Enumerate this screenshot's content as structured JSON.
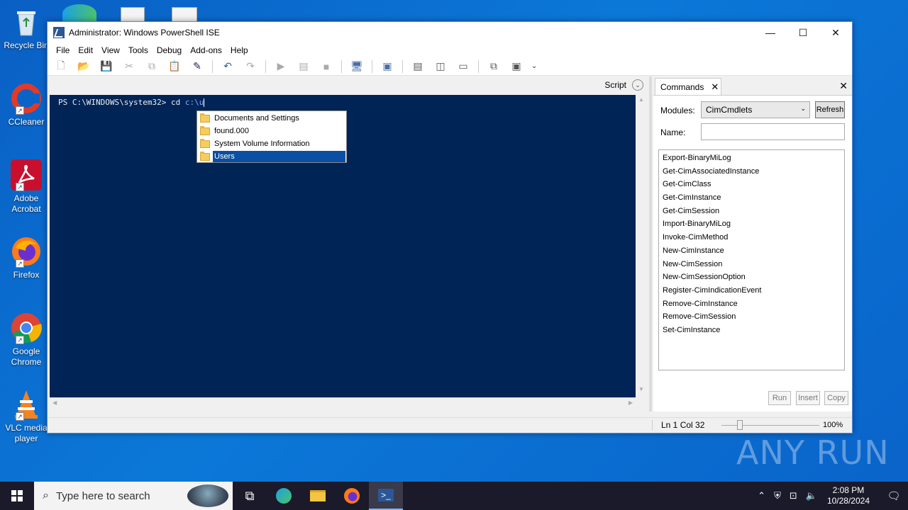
{
  "desktop": {
    "icons": [
      {
        "label": "Recycle Bin",
        "icon": "recycle-bin-icon"
      },
      {
        "label": "CCleaner",
        "icon": "ccleaner-icon"
      },
      {
        "label": "Adobe Acrobat",
        "icon": "adobe-acrobat-icon"
      },
      {
        "label": "Firefox",
        "icon": "firefox-icon"
      },
      {
        "label": "Google Chrome",
        "icon": "chrome-icon"
      },
      {
        "label": "VLC media player",
        "icon": "vlc-icon"
      }
    ],
    "watermark": "ANY RUN"
  },
  "window": {
    "title": "Administrator: Windows PowerShell ISE",
    "menu": [
      "File",
      "Edit",
      "View",
      "Tools",
      "Debug",
      "Add-ons",
      "Help"
    ],
    "script_label": "Script"
  },
  "console": {
    "prompt": "PS C:\\WINDOWS\\system32>",
    "command": "cd",
    "argument": "c:\\u"
  },
  "autocomplete": {
    "items": [
      "Documents and Settings",
      "found.000",
      "System Volume Information",
      "Users"
    ],
    "selected": "Users"
  },
  "commands_pane": {
    "tab_label": "Commands",
    "modules_label": "Modules:",
    "module_selected": "CimCmdlets",
    "refresh_label": "Refresh",
    "name_label": "Name:",
    "name_value": "",
    "commands": [
      "Export-BinaryMiLog",
      "Get-CimAssociatedInstance",
      "Get-CimClass",
      "Get-CimInstance",
      "Get-CimSession",
      "Import-BinaryMiLog",
      "Invoke-CimMethod",
      "New-CimInstance",
      "New-CimSession",
      "New-CimSessionOption",
      "Register-CimIndicationEvent",
      "Remove-CimInstance",
      "Remove-CimSession",
      "Set-CimInstance"
    ],
    "run_label": "Run",
    "insert_label": "Insert",
    "copy_label": "Copy"
  },
  "status": {
    "position": "Ln 1  Col 32",
    "zoom": "100%"
  },
  "taskbar": {
    "search_placeholder": "Type here to search",
    "time": "2:08 PM",
    "date": "10/28/2024"
  }
}
